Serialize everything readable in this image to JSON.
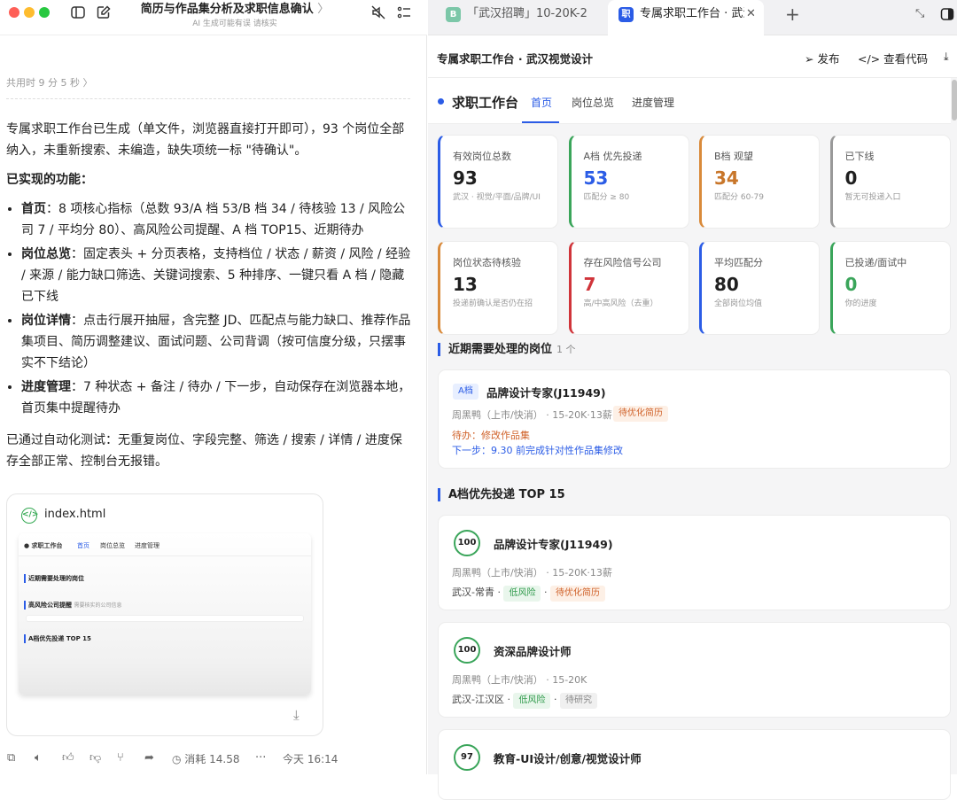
{
  "left": {
    "doc_title": "简历与作品集分析及求职信息确认",
    "doc_subtitle": "AI 生成可能有误 请核实",
    "elapsed": "共用时 9 分 5 秒",
    "intro": "专属求职工作台已生成（单文件，浏览器直接打开即可），93 个岗位全部纳入，未重新搜索、未编造，缺失项统一标 \"待确认\"。",
    "features_heading": "已实现的功能：",
    "features": [
      {
        "name": "首页",
        "text": "：8 项核心指标（总数 93/A 档 53/B 档 34 / 待核验 13 / 风险公司 7 / 平均分 80）、高风险公司提醒、A 档 TOP15、近期待办"
      },
      {
        "name": "岗位总览",
        "text": "：固定表头 + 分页表格，支持档位 / 状态 / 薪资 / 风险 / 经验 / 来源 / 能力缺口筛选、关键词搜索、5 种排序、一键只看 A 档 / 隐藏已下线"
      },
      {
        "name": "岗位详情",
        "text": "：点击行展开抽屉，含完整 JD、匹配点与能力缺口、推荐作品集项目、简历调整建议、面试问题、公司背调（按可信度分级，只摆事实不下结论）"
      },
      {
        "name": "进度管理",
        "text": "：7 种状态 + 备注 / 待办 / 下一步，自动保存在浏览器本地，首页集中提醒待办"
      }
    ],
    "test_note": "已通过自动化测试：无重复岗位、字段完整、筛选 / 搜索 / 详情 / 进度保存全部正常、控制台无报错。",
    "file": {
      "name": "index.html",
      "preview_brand": "求职工作台",
      "preview_tabs": [
        "首页",
        "岗位总览",
        "进度管理"
      ],
      "preview_sections": [
        "近期需要处理的岗位",
        "高风险公司提醒",
        "A档优先投递 TOP 15"
      ],
      "preview_hint": "需要核实的公司信息"
    },
    "footer": {
      "cost": "消耗 14.58",
      "time": "今天 16:14"
    }
  },
  "browser": {
    "tabs": [
      {
        "label": "「武汉招聘」10-20K-2",
        "fav": "B",
        "fav_color": "#7cc7a8"
      },
      {
        "label": "专属求职工作台 · 武汉",
        "fav": "职",
        "fav_color": "#2b5ce6"
      }
    ],
    "page_title": "专属求职工作台 · 武汉视觉设计",
    "actions": {
      "publish": "发布",
      "code": "查看代码"
    }
  },
  "app": {
    "brand": "求职工作台",
    "nav": [
      "首页",
      "岗位总览",
      "进度管理"
    ],
    "stats": [
      {
        "label": "有效岗位总数",
        "value": "93",
        "sub": "武汉 · 视觉/平面/品牌/UI",
        "color": "#2b5ce6",
        "vcolor": "#1f1f1f"
      },
      {
        "label": "A档 优先投递",
        "value": "53",
        "sub": "匹配分 ≥ 80",
        "color": "#3aa55a",
        "vcolor": "#2b5ce6"
      },
      {
        "label": "B档 观望",
        "value": "34",
        "sub": "匹配分 60-79",
        "color": "#d98a3a",
        "vcolor": "#c8762a"
      },
      {
        "label": "已下线",
        "value": "0",
        "sub": "暂无可投递入口",
        "color": "#999999",
        "vcolor": "#1f1f1f"
      },
      {
        "label": "岗位状态待核验",
        "value": "13",
        "sub": "投递前确认是否仍在招",
        "color": "#d98a3a",
        "vcolor": "#1f1f1f"
      },
      {
        "label": "存在风险信号公司",
        "value": "7",
        "sub": "高/中高风险（去重）",
        "color": "#d0343a",
        "vcolor": "#d0343a"
      },
      {
        "label": "平均匹配分",
        "value": "80",
        "sub": "全部岗位均值",
        "color": "#2b5ce6",
        "vcolor": "#1f1f1f"
      },
      {
        "label": "已投递/面试中",
        "value": "0",
        "sub": "你的进度",
        "color": "#3aa55a",
        "vcolor": "#3aa55a"
      }
    ],
    "recent": {
      "title": "近期需要处理的岗位",
      "count": "1 个",
      "item": {
        "grade": "A档",
        "title": "品牌设计专家(J11949)",
        "meta": "周黑鸭（上市/快消） · 15-20K·13薪 ·",
        "status": "待优化简历",
        "todo": "待办：修改作品集",
        "next": "下一步：9.30 前完成针对性作品集修改"
      }
    },
    "top": {
      "title": "A档优先投递 TOP 15",
      "items": [
        {
          "score": "100",
          "title": "品牌设计专家(J11949)",
          "meta": "周黑鸭（上市/快消） · 15-20K·13薪",
          "loc": "武汉-常青 ·",
          "risk": "低风险",
          "status": "待优化简历",
          "status_kind": "warn"
        },
        {
          "score": "100",
          "title": "资深品牌设计师",
          "meta": "周黑鸭（上市/快消） · 15-20K",
          "loc": "武汉-江汉区 ·",
          "risk": "低风险",
          "status": "待研究",
          "status_kind": "gray"
        },
        {
          "score": "97",
          "title": "教育-UI设计/创意/视觉设计师"
        }
      ]
    }
  }
}
